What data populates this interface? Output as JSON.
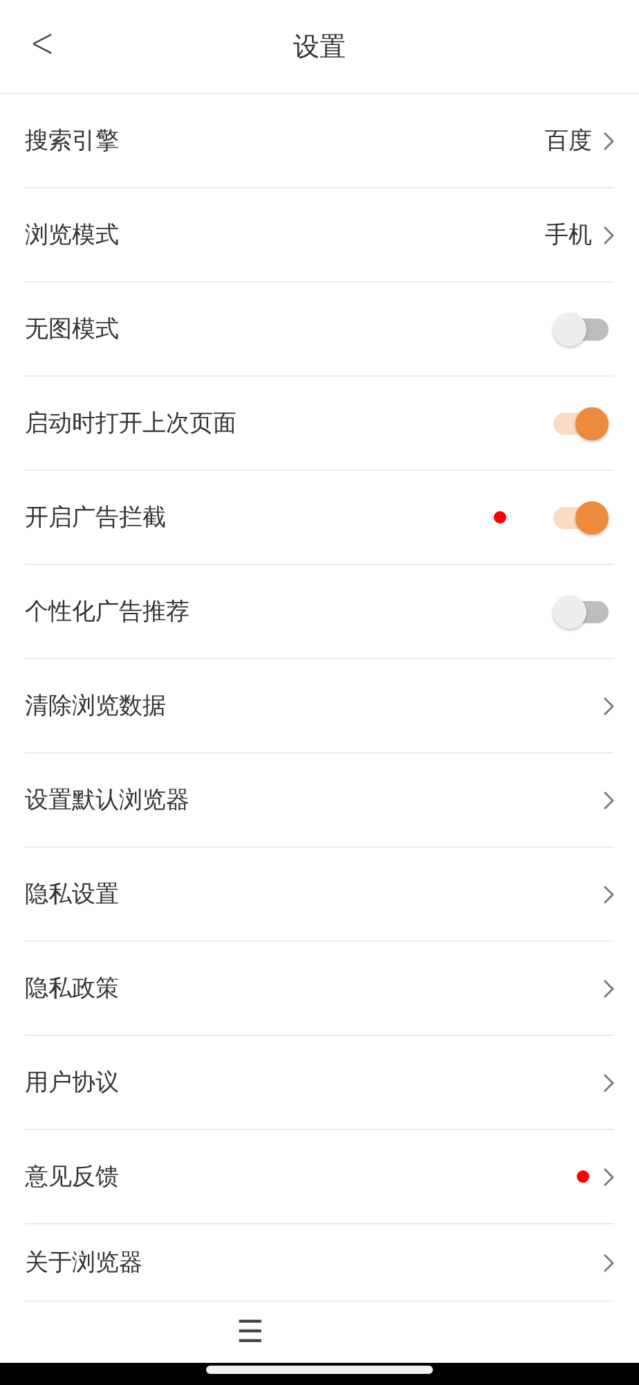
{
  "header": {
    "back": "<",
    "title": "设置"
  },
  "items": [
    {
      "kind": "link",
      "label": "搜索引擎",
      "value": "百度",
      "dot": false
    },
    {
      "kind": "link",
      "label": "浏览模式",
      "value": "手机",
      "dot": false
    },
    {
      "kind": "toggle",
      "label": "无图模式",
      "on": false,
      "dot": false
    },
    {
      "kind": "toggle",
      "label": "启动时打开上次页面",
      "on": true,
      "dot": false
    },
    {
      "kind": "toggle",
      "label": "开启广告拦截",
      "on": true,
      "dot": true
    },
    {
      "kind": "toggle",
      "label": "个性化广告推荐",
      "on": false,
      "dot": false
    },
    {
      "kind": "link",
      "label": "清除浏览数据",
      "dot": false
    },
    {
      "kind": "link",
      "label": "设置默认浏览器",
      "dot": false
    },
    {
      "kind": "link",
      "label": "隐私设置",
      "dot": false
    },
    {
      "kind": "link",
      "label": "隐私政策",
      "dot": false
    },
    {
      "kind": "link",
      "label": "用户协议",
      "dot": false
    },
    {
      "kind": "link",
      "label": "意见反馈",
      "dot": true
    },
    {
      "kind": "link",
      "label": "关于浏览器",
      "dot": false
    }
  ],
  "toolbar": {
    "menu": "☰"
  }
}
